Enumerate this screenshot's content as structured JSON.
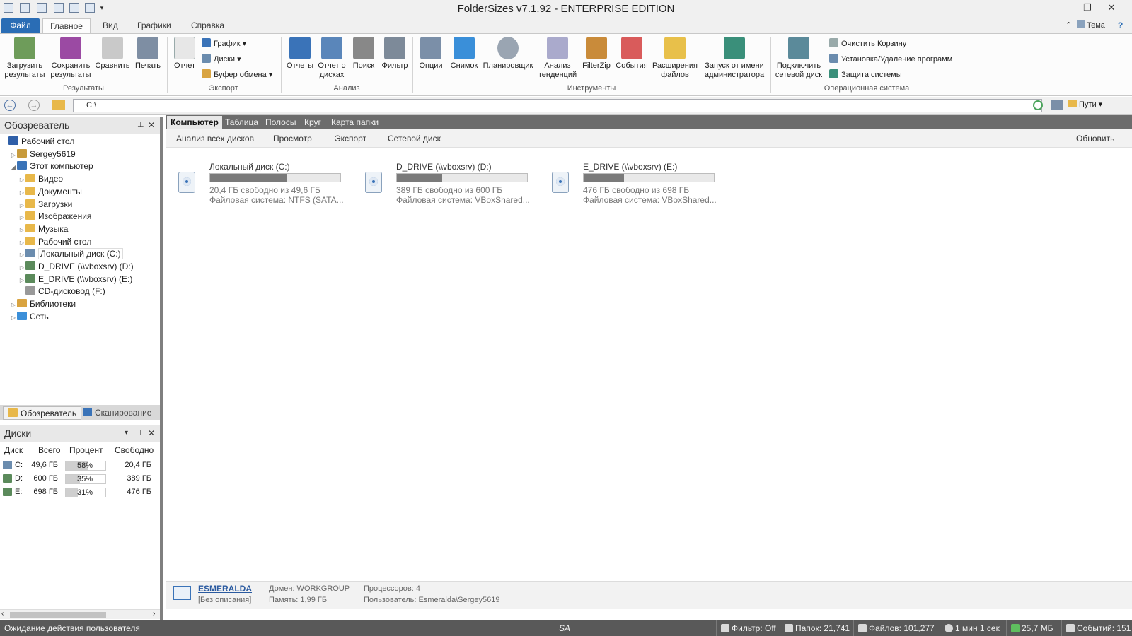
{
  "window": {
    "title": "FolderSizes v7.1.92 - ENTERPRISE EDITION",
    "theme_label": "Тема"
  },
  "ribbon_tabs": [
    "Файл",
    "Главное",
    "Вид",
    "Графики",
    "Справка"
  ],
  "ribbon": {
    "groups": {
      "results": "Результаты",
      "export": "Экспорт",
      "analysis": "Анализ",
      "tools": "Инструменты",
      "os": "Операционная система"
    },
    "buttons": {
      "load_results": "Загрузить результаты",
      "save_results": "Сохранить результаты",
      "compare": "Сравнить",
      "print": "Печать",
      "report": "Отчет",
      "graph": "График",
      "disks": "Диски",
      "clipboard": "Буфер обмена",
      "reports": "Отчеты",
      "disk_report": "Отчет о дисках",
      "search": "Поиск",
      "filter": "Фильтр",
      "options": "Опции",
      "snapshot": "Снимок",
      "scheduler": "Планировщик",
      "trend_analysis": "Анализ тенденций",
      "filterzip": "FilterZip",
      "events": "События",
      "file_extensions": "Расширения файлов",
      "run_as_admin": "Запуск от имени администратора",
      "connect_network_drive": "Подключить сетевой диск",
      "empty_recycle": "Очистить Корзину",
      "install_remove": "Установка/Удаление программ",
      "system_protection": "Защита системы"
    }
  },
  "address": {
    "path": "C:\\",
    "paths_button": "Пути"
  },
  "explorer": {
    "title": "Обозреватель",
    "tree": [
      {
        "label": "Рабочий стол",
        "icon": "desktop-icon",
        "depth": 0
      },
      {
        "label": "Sergey5619",
        "icon": "user-folder-icon",
        "depth": 1
      },
      {
        "label": "Этот компьютер",
        "icon": "computer-icon",
        "depth": 1
      },
      {
        "label": "Видео",
        "icon": "folder-icon",
        "depth": 2
      },
      {
        "label": "Документы",
        "icon": "folder-icon",
        "depth": 2
      },
      {
        "label": "Загрузки",
        "icon": "folder-icon",
        "depth": 2
      },
      {
        "label": "Изображения",
        "icon": "folder-icon",
        "depth": 2
      },
      {
        "label": "Музыка",
        "icon": "folder-icon",
        "depth": 2
      },
      {
        "label": "Рабочий стол",
        "icon": "folder-icon",
        "depth": 2
      },
      {
        "label": "Локальный диск (C:)",
        "icon": "local-drive-icon",
        "depth": 2
      },
      {
        "label": "D_DRIVE (\\\\vboxsrv) (D:)",
        "icon": "network-drive-icon",
        "depth": 2
      },
      {
        "label": "E_DRIVE (\\\\vboxsrv) (E:)",
        "icon": "network-drive-icon",
        "depth": 2
      },
      {
        "label": "CD-дисковод (F:)",
        "icon": "cd-drive-icon",
        "depth": 2
      },
      {
        "label": "Библиотеки",
        "icon": "library-icon",
        "depth": 1
      },
      {
        "label": "Сеть",
        "icon": "network-icon",
        "depth": 1
      }
    ],
    "tabs": [
      "Обозреватель",
      "Сканирование"
    ]
  },
  "disks_panel": {
    "title": "Диски",
    "columns": [
      "Диск",
      "Всего",
      "Процент",
      "Свободно"
    ],
    "rows": [
      {
        "disk": "C:",
        "total": "49,6 ГБ",
        "percent": "58%",
        "percent_value": 58,
        "free": "20,4 ГБ"
      },
      {
        "disk": "D:",
        "total": "600 ГБ",
        "percent": "35%",
        "percent_value": 35,
        "free": "389 ГБ"
      },
      {
        "disk": "E:",
        "total": "698 ГБ",
        "percent": "31%",
        "percent_value": 31,
        "free": "476 ГБ"
      }
    ]
  },
  "main_tabs": [
    "Компьютер",
    "Таблица",
    "Полосы",
    "Круг",
    "Карта папки"
  ],
  "sub_toolbar": {
    "analyze_all": "Анализ всех дисков",
    "view": "Просмотр",
    "export": "Экспорт",
    "network_drive": "Сетевой диск",
    "refresh": "Обновить"
  },
  "drives": [
    {
      "name": "Локальный диск (C:)",
      "used_fraction": 0.59,
      "free_text": "20,4 ГБ свободно из 49,6 ГБ",
      "fs_text": "Файловая система: NTFS (SATA..."
    },
    {
      "name": "D_DRIVE (\\\\vboxsrv) (D:)",
      "used_fraction": 0.35,
      "free_text": "389 ГБ свободно из 600 ГБ",
      "fs_text": "Файловая система: VBoxShared..."
    },
    {
      "name": "E_DRIVE (\\\\vboxsrv) (E:)",
      "used_fraction": 0.31,
      "free_text": "476 ГБ свободно из 698 ГБ",
      "fs_text": "Файловая система: VBoxShared..."
    }
  ],
  "computer_info": {
    "name": "ESMERALDA",
    "description": "[Без описания]",
    "domain": "Домен: WORKGROUP",
    "memory": "Память: 1,99 ГБ",
    "processors": "Процессоров: 4",
    "user": "Пользователь: Esmeralda\\Sergey5619"
  },
  "status": {
    "message": "Ожидание действия пользователя",
    "sa": "SA",
    "filter": "Фильтр: Off",
    "folders": "Папок: 21,741",
    "files": "Файлов: 101,277",
    "time": "1 мин 1 сек",
    "memory": "25,7 МБ",
    "events": "Событий: 151"
  },
  "colors": {
    "file_tab": "#2a6db5",
    "status_bar": "#595959",
    "main_tab_strip": "#6c6c6c",
    "bar_fill": "#7a7a7a"
  }
}
